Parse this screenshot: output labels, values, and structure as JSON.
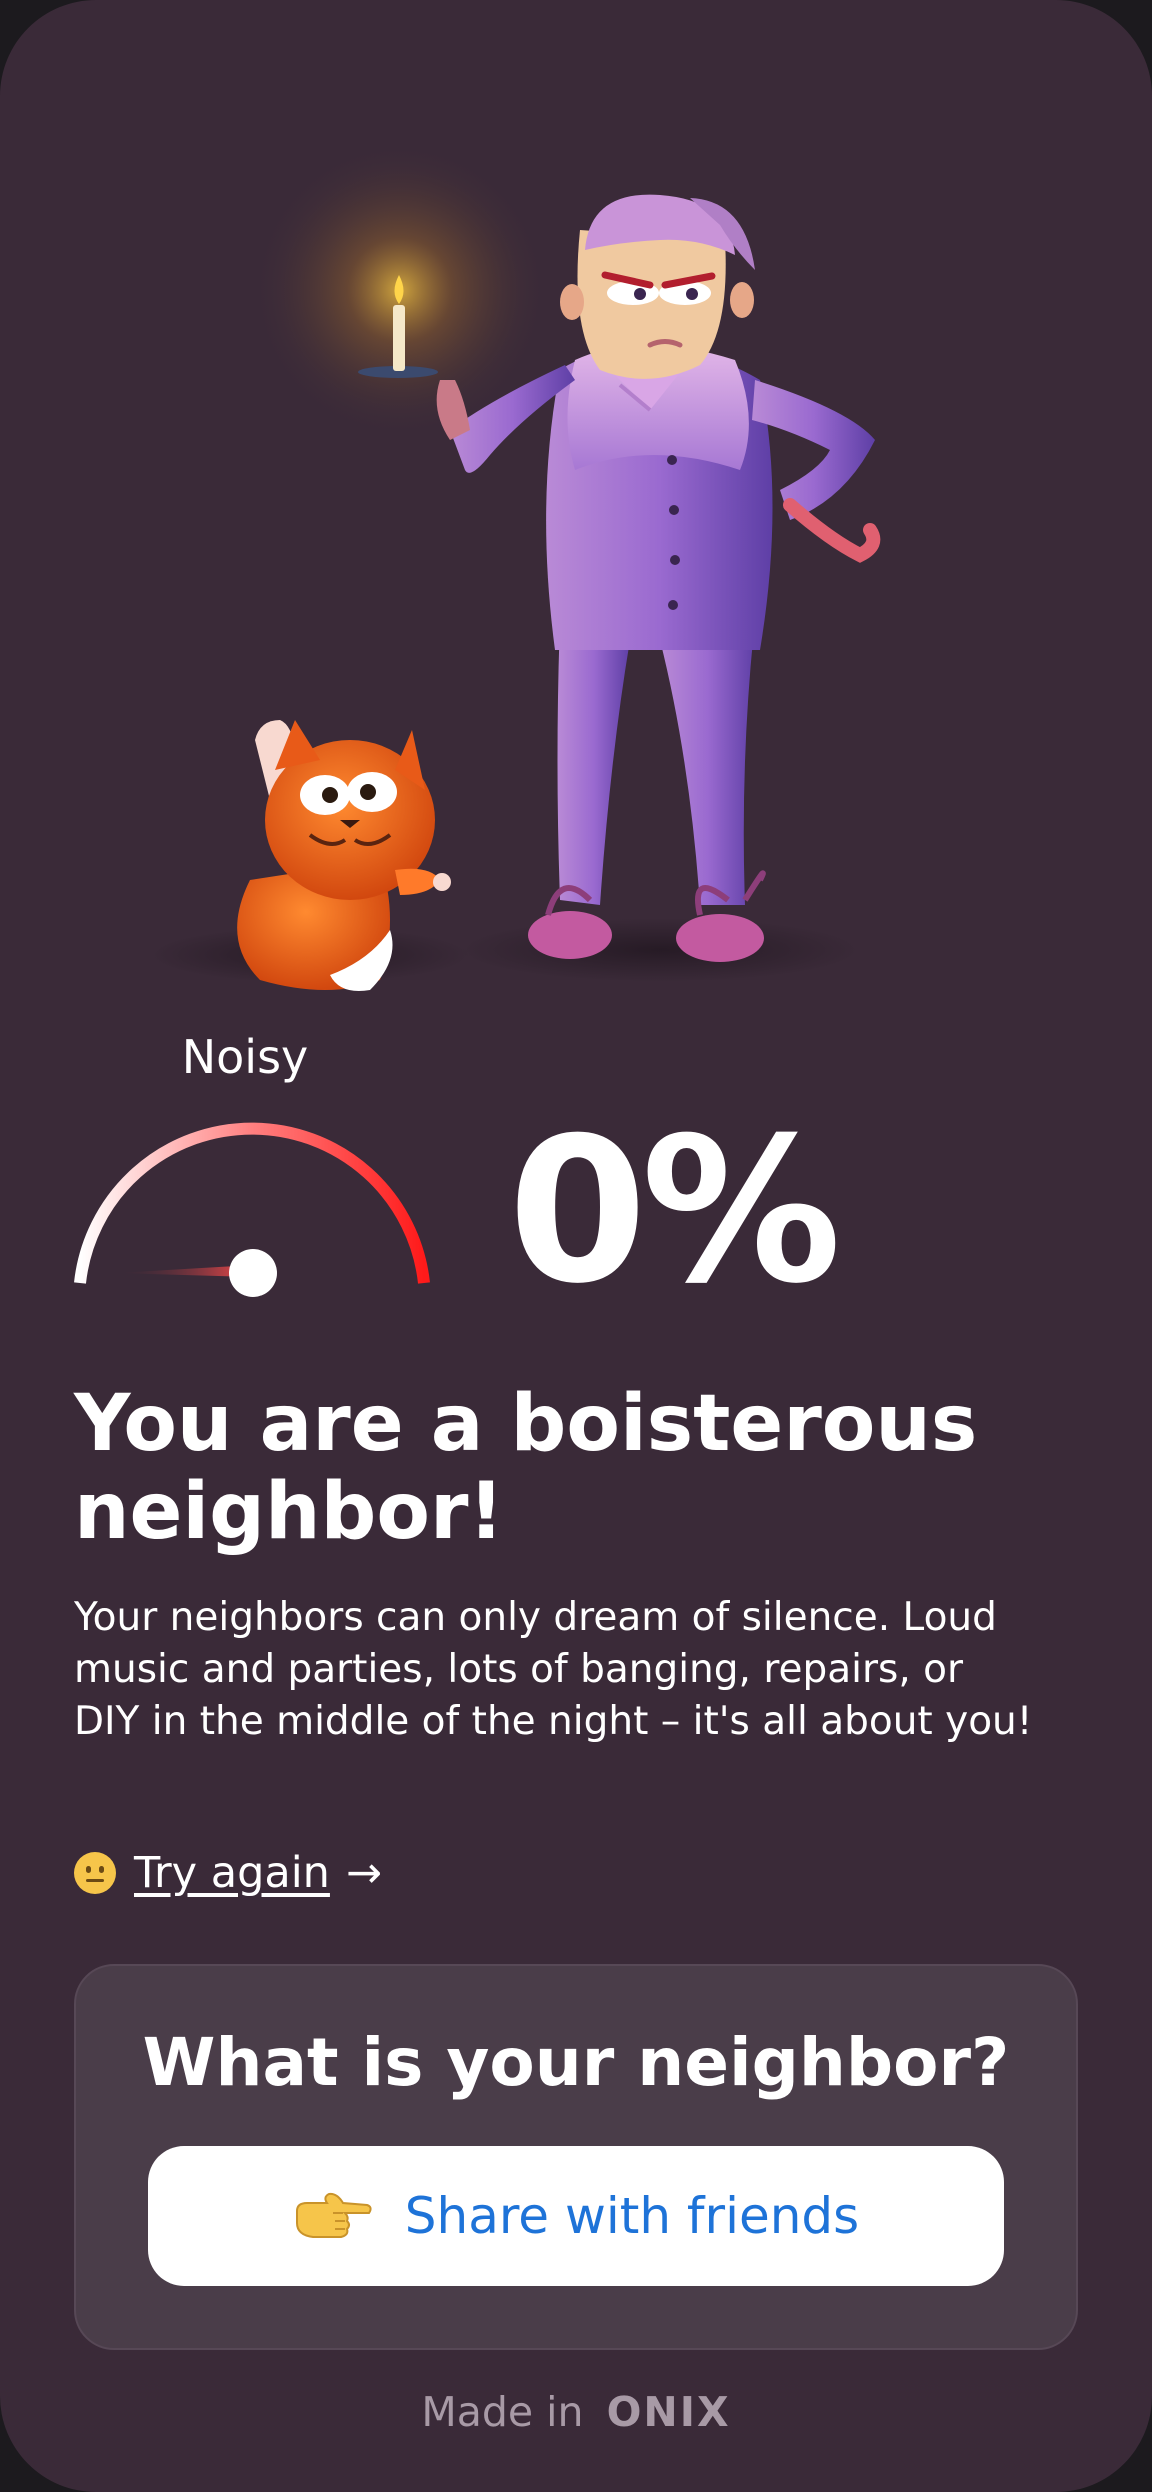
{
  "gauge": {
    "label": "Noisy",
    "value_percent": 0,
    "value_text": "0%"
  },
  "result": {
    "title": "You are a boisterous neighbor!",
    "description": "Your neighbors can only dream of silence. Loud music and parties, lots of banging, repairs, or DIY in the middle of the night – it's all about you!"
  },
  "retry": {
    "emoji": "neutral-face-emoji",
    "label": "Try again",
    "arrow": "→"
  },
  "share_card": {
    "title": "What is your neighbor?",
    "button_icon": "pointing-hand-icon",
    "button_label": "Share with friends"
  },
  "footer": {
    "prefix": "Made in",
    "brand": "ONIX"
  },
  "colors": {
    "background": "#3a2a38",
    "card": "#4a3d49",
    "accent_blue": "#1e73d8",
    "gauge_red": "#ff1a1a"
  }
}
